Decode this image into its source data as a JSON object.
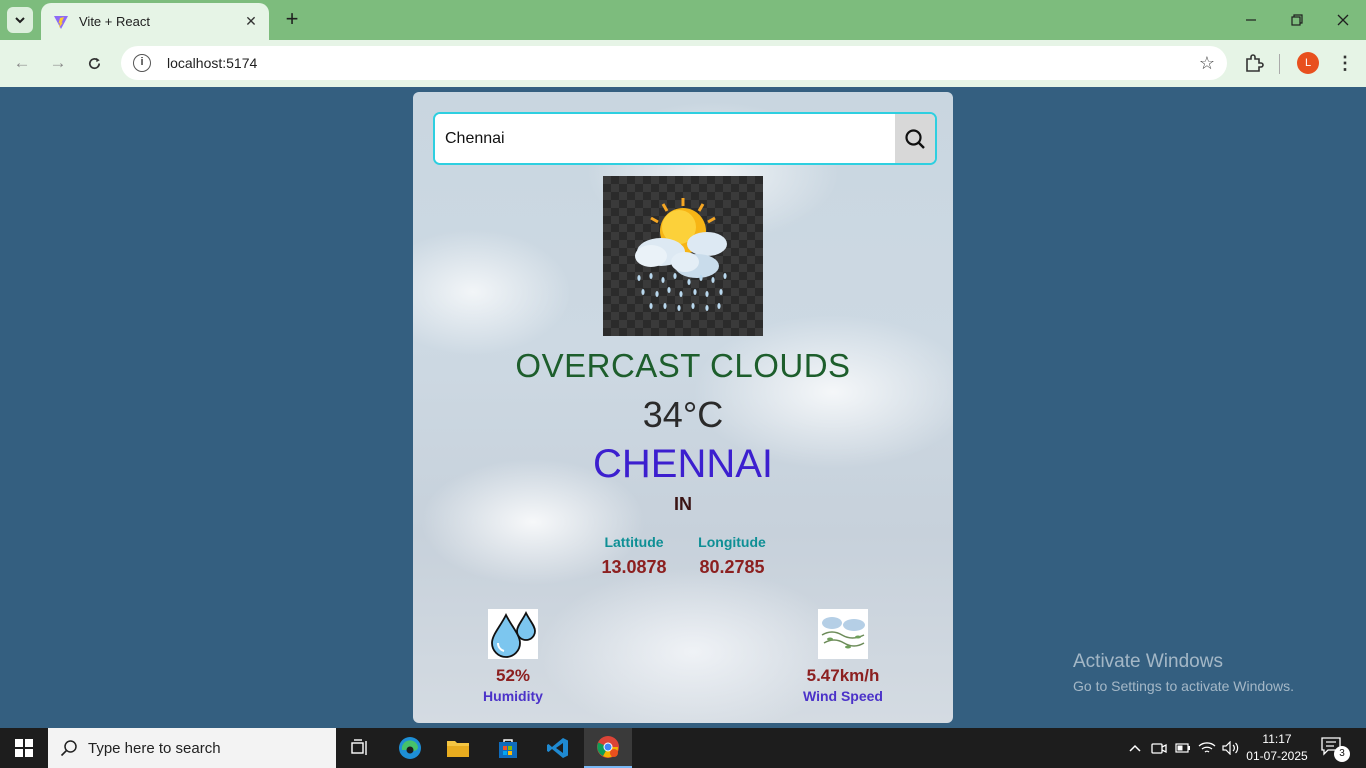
{
  "browser": {
    "tab_title": "Vite + React",
    "url": "localhost:5174",
    "profile_initial": "L"
  },
  "weather": {
    "search_value": "Chennai",
    "description": "OVERCAST CLOUDS",
    "temperature": "34°C",
    "city": "CHENNAI",
    "country": "IN",
    "latitude_label": "Lattitude",
    "latitude_value": "13.0878",
    "longitude_label": "Longitude",
    "longitude_value": "80.2785",
    "humidity_value": "52%",
    "humidity_label": "Humidity",
    "wind_value": "5.47km/h",
    "wind_label": "Wind Speed"
  },
  "watermark": {
    "title": "Activate Windows",
    "subtitle": "Go to Settings to activate Windows."
  },
  "taskbar": {
    "search_placeholder": "Type here to search",
    "time": "11:17",
    "date": "01-07-2025",
    "notification_count": "3"
  },
  "colors": {
    "page_bg": "#345f80",
    "tab_bar": "#7dbc7d",
    "search_border": "#2ecfe0",
    "description": "#1d5e2c",
    "city": "#3c1fcf",
    "values": "#8c2020",
    "coord_labels": "#0e8f95",
    "stat_labels": "#4b32c9"
  },
  "icons": [
    "chevron-down-icon",
    "vite-icon",
    "close-icon",
    "plus-icon",
    "minimize-icon",
    "restore-icon",
    "back-icon",
    "forward-icon",
    "reload-icon",
    "info-icon",
    "star-icon",
    "extensions-icon",
    "kebab-icon",
    "search-icon",
    "weather-icon",
    "humidity-icon",
    "wind-icon",
    "windows-icon",
    "task-view-icon",
    "edge-icon",
    "file-explorer-icon",
    "store-icon",
    "vscode-icon",
    "chrome-icon",
    "wifi-icon",
    "volume-icon",
    "battery-icon",
    "notification-icon"
  ]
}
